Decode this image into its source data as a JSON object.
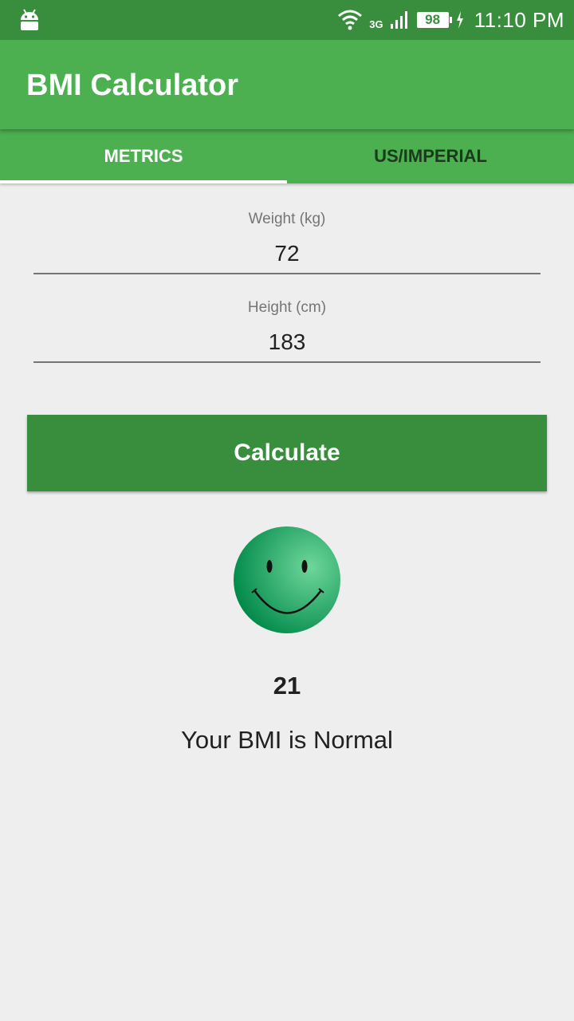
{
  "status_bar": {
    "network": "3G",
    "battery": "98",
    "time": "11:10 PM",
    "icons": [
      "android-icon",
      "wifi-icon",
      "signal-icon",
      "battery-icon",
      "charging-icon"
    ]
  },
  "app": {
    "title": "BMI Calculator"
  },
  "tabs": [
    {
      "label": "METRICS",
      "active": true
    },
    {
      "label": "US/IMPERIAL",
      "active": false
    }
  ],
  "form": {
    "weight_label": "Weight (kg)",
    "weight_value": "72",
    "height_label": "Height (cm)",
    "height_value": "183",
    "calculate_label": "Calculate"
  },
  "result": {
    "icon": "smiley-face-icon",
    "value": "21",
    "status": "Your BMI is Normal"
  },
  "colors": {
    "status_bar": "#388e3c",
    "primary": "#4caf50",
    "button": "#388e3c",
    "background": "#eeeeee"
  }
}
